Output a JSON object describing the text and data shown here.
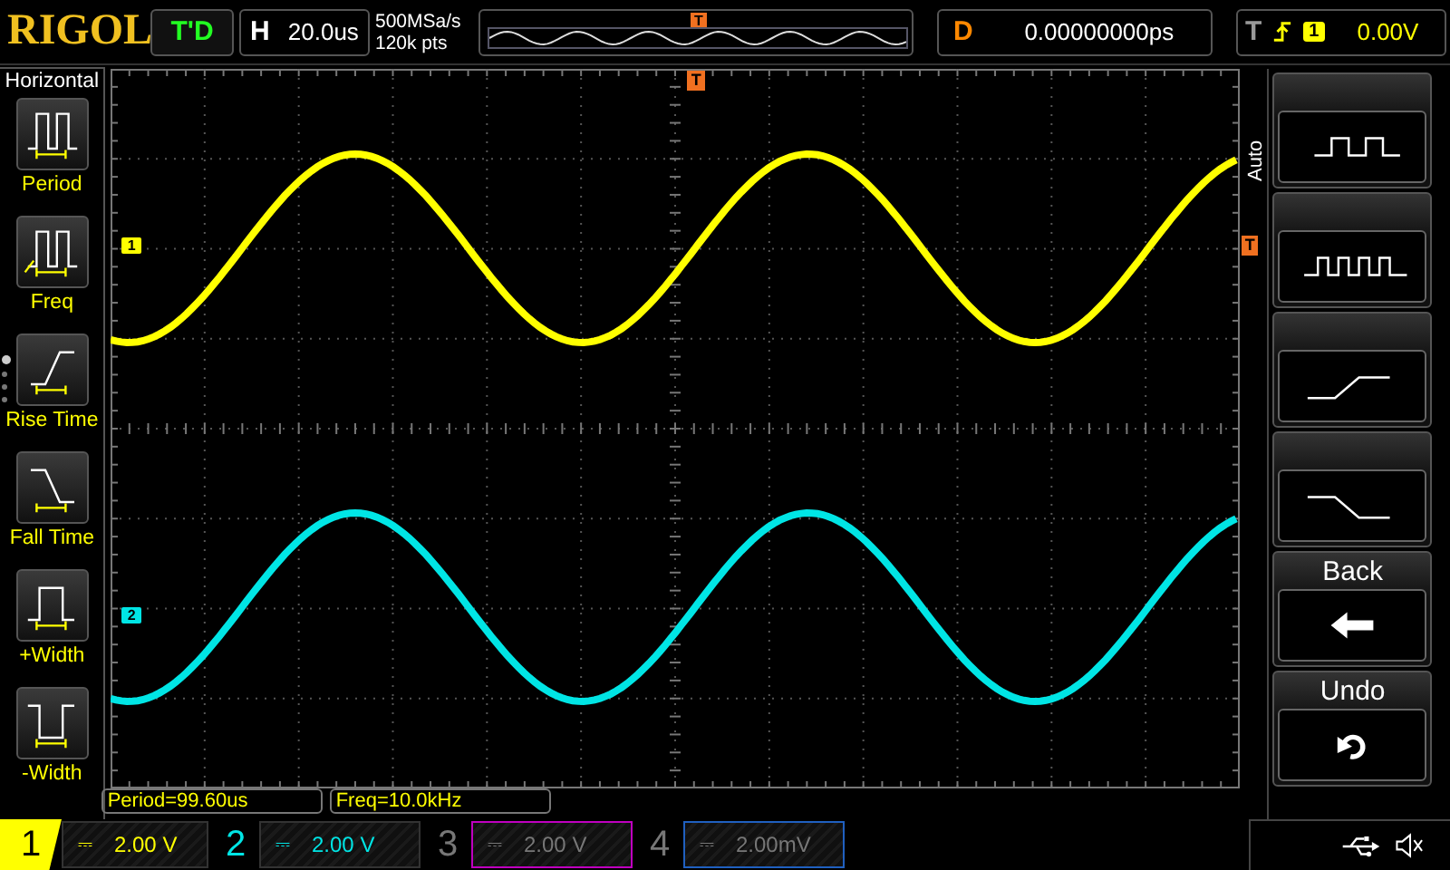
{
  "brand": "RIGOL",
  "run_status": "T'D",
  "timebase": {
    "label": "H",
    "value": "20.0us"
  },
  "acquisition": [
    "500MSa/s",
    "120k pts"
  ],
  "overview_marker": "T",
  "delay": {
    "label": "D",
    "value": "0.00000000ps"
  },
  "trigger": {
    "label": "T",
    "source": "1",
    "level": "0.00V"
  },
  "left_menu": {
    "title": "Horizontal",
    "items": [
      {
        "label": "Period",
        "kind": "period"
      },
      {
        "label": "Freq",
        "kind": "freq"
      },
      {
        "label": "Rise Time",
        "kind": "rise"
      },
      {
        "label": "Fall Time",
        "kind": "fall"
      },
      {
        "label": "+Width",
        "kind": "pwidth"
      },
      {
        "label": "-Width",
        "kind": "nwidth"
      }
    ],
    "pages": [
      {
        "selected": true
      },
      {
        "selected": false
      },
      {
        "selected": false
      },
      {
        "selected": false
      }
    ]
  },
  "plot": {
    "trigger_marker": "T",
    "level_marker": "T",
    "channel_markers": [
      {
        "label": "1",
        "color": "#ffff00"
      },
      {
        "label": "2",
        "color": "#00e5e5"
      }
    ]
  },
  "right_menu": {
    "tab": "Auto",
    "buttons": [
      {
        "kind": "slow-pulse"
      },
      {
        "kind": "fast-pulse"
      },
      {
        "kind": "rise"
      },
      {
        "kind": "fall"
      },
      {
        "kind": "back",
        "label": "Back"
      },
      {
        "kind": "undo",
        "label": "Undo"
      }
    ]
  },
  "measurements": [
    "Period=99.60us",
    "Freq=10.0kHz"
  ],
  "channels": [
    {
      "number": "1",
      "coupling": "⎓",
      "scale": "2.00 V",
      "color": "#ffff00",
      "selected": true,
      "enabled": true
    },
    {
      "number": "2",
      "coupling": "⎓",
      "scale": "2.00 V",
      "color": "#00e5e5",
      "selected": false,
      "enabled": true
    },
    {
      "number": "3",
      "coupling": "⎓",
      "scale": "2.00 V",
      "color": "#c000c0",
      "selected": false,
      "enabled": false
    },
    {
      "number": "4",
      "coupling": "⎓",
      "scale": "2.00mV",
      "color": "#2060c0",
      "selected": false,
      "enabled": false
    }
  ]
}
